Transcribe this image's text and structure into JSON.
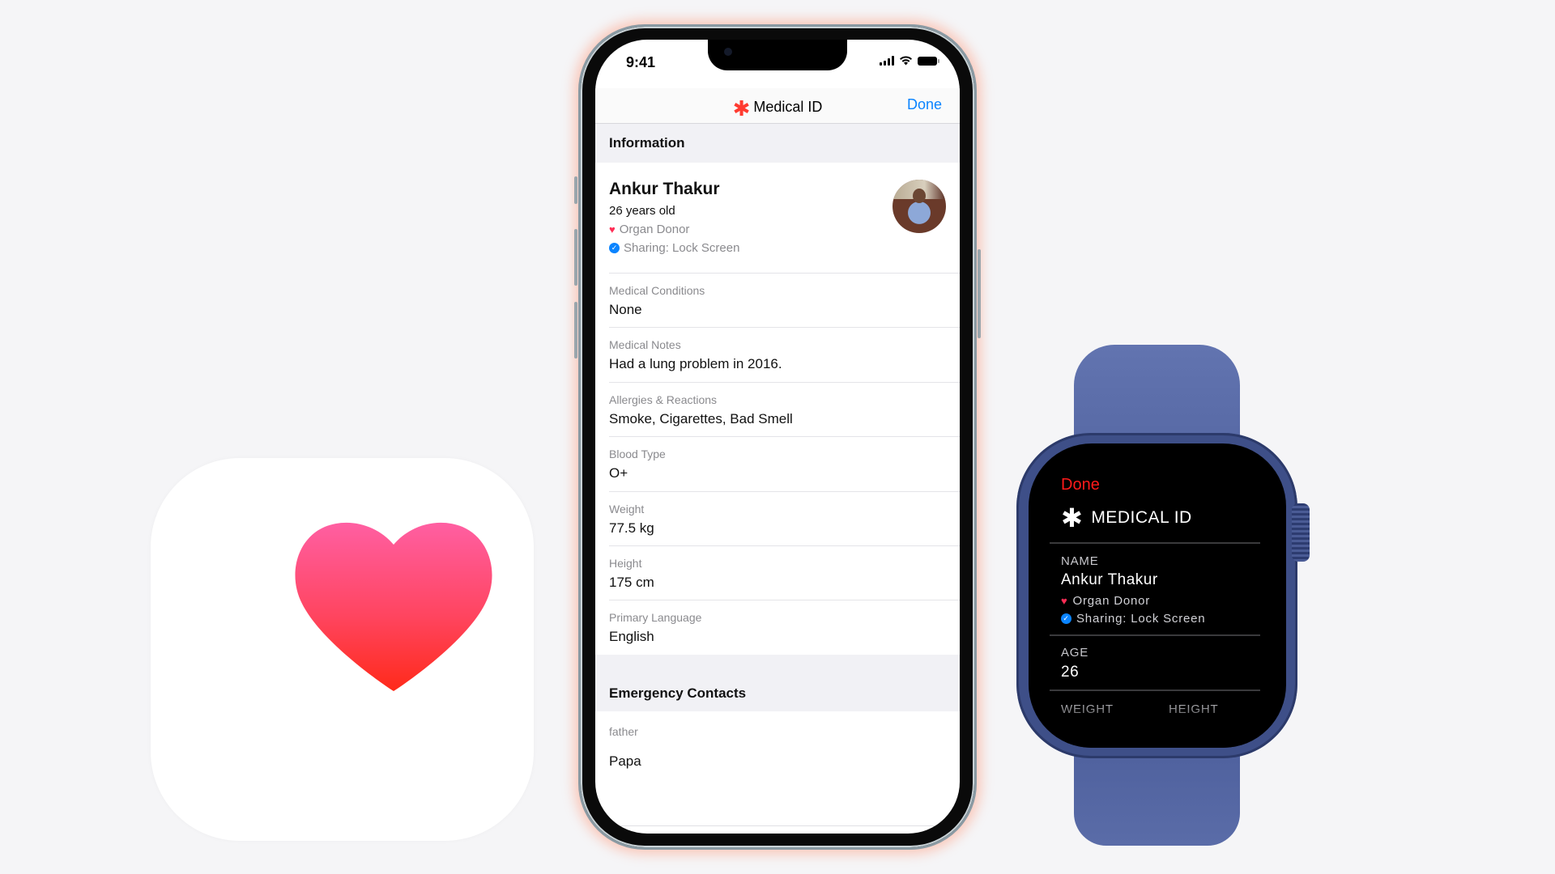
{
  "health_app_icon": {
    "icon": "heart-icon",
    "gradient_top": "#ff5fa2",
    "gradient_bottom": "#ff2a1a"
  },
  "phone": {
    "status_bar": {
      "time": "9:41",
      "icons": [
        "cellular-signal-icon",
        "wifi-icon",
        "battery-icon"
      ]
    },
    "nav": {
      "icon": "medical-asterisk-icon",
      "title": "Medical ID",
      "done_label": "Done",
      "accent": "#0a84ff",
      "asterisk_color": "#ff3b30"
    },
    "information": {
      "header": "Information",
      "name": "Ankur Thakur",
      "age": "26 years old",
      "organ_donor": "Organ Donor",
      "sharing": "Sharing: Lock Screen"
    },
    "fields": [
      {
        "label": "Medical Conditions",
        "value": "None"
      },
      {
        "label": "Medical Notes",
        "value": "Had a lung problem in 2016."
      },
      {
        "label": "Allergies & Reactions",
        "value": "Smoke, Cigarettes, Bad Smell"
      },
      {
        "label": "Blood Type",
        "value": "O+"
      },
      {
        "label": "Weight",
        "value": "77.5 kg"
      },
      {
        "label": "Height",
        "value": "175 cm"
      },
      {
        "label": "Primary Language",
        "value": "English"
      }
    ],
    "emergency": {
      "header": "Emergency Contacts",
      "contacts": [
        {
          "relationship": "father",
          "name": "Papa"
        }
      ]
    }
  },
  "watch": {
    "done_label": "Done",
    "title": "MEDICAL ID",
    "name_label": "NAME",
    "name": "Ankur Thakur",
    "organ_donor": "Organ Donor",
    "sharing": "Sharing: Lock Screen",
    "age_label": "AGE",
    "age": "26",
    "weight_label": "WEIGHT",
    "height_label": "HEIGHT",
    "done_color": "#ff1a1a",
    "band_color": "#5a6ca8"
  }
}
